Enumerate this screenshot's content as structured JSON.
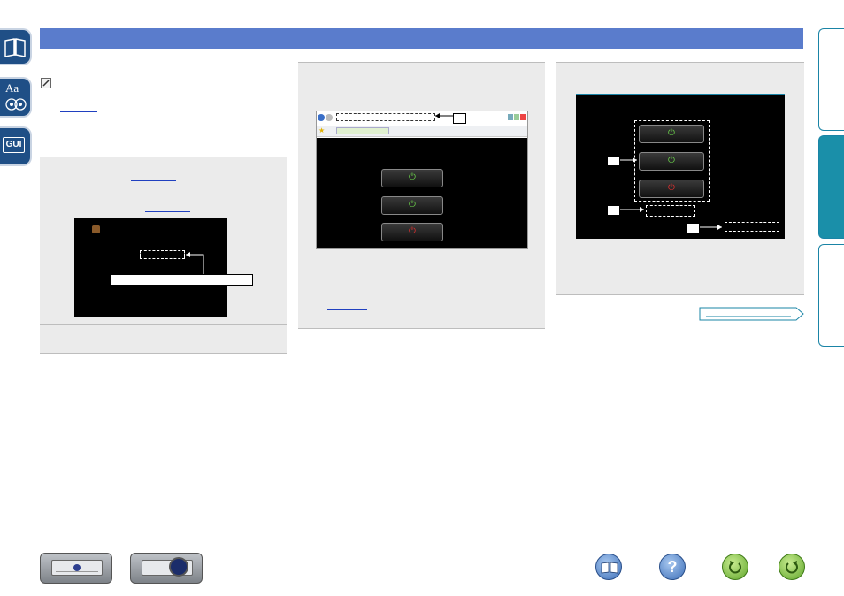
{
  "sidebar": {
    "icons": [
      {
        "name": "book-icon"
      },
      {
        "name": "glossary-icon",
        "text": "Aa"
      },
      {
        "name": "gui-icon",
        "text": "GUI"
      }
    ]
  },
  "colors": {
    "header_band": "#5a7ccc",
    "step_box": "#ebebeb",
    "tab_active": "#1a8fa9",
    "link": "#2040c0"
  },
  "footer": {
    "device_buttons": [
      "receiver-front-panel-icon",
      "remote-control-icon"
    ],
    "nav_buttons": [
      "contents-icon",
      "help-icon",
      "back-icon",
      "forward-icon"
    ]
  }
}
